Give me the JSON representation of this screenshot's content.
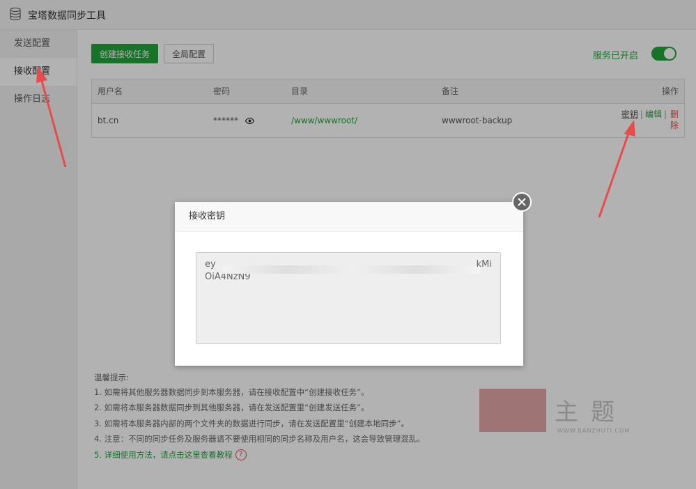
{
  "window": {
    "title": "宝塔数据同步工具"
  },
  "sidebar": {
    "items": [
      {
        "label": "发送配置"
      },
      {
        "label": "接收配置"
      },
      {
        "label": "操作日志"
      }
    ]
  },
  "toolbar": {
    "create_label": "创建接收任务",
    "global_label": "全局配置",
    "service_status": "服务已开启",
    "service_on": true
  },
  "table": {
    "headers": [
      "用户名",
      "密码",
      "目录",
      "备注",
      "操作"
    ],
    "rows": [
      {
        "username": "bt.cn",
        "password": "******",
        "dir": "/www/wwwroot/",
        "note": "wwwroot-backup",
        "ops": {
          "key": "密钥",
          "sep": "|",
          "edit": "编辑",
          "del": "删除"
        }
      }
    ]
  },
  "tips": {
    "title": "温馨提示:",
    "lines": [
      "1. 如需将其他服务器数据同步到本服务器，请在接收配置中“创建接收任务”。",
      "2. 如需将本服务器数据同步到其他服务器，请在发送配置里“创建发送任务”。",
      "3. 如需将本服务器内部的两个文件夹的数据进行同步，请在发送配置里“创建本地同步”。",
      "4. 注意：不同的同步任务及服务器请不要使用相同的同步名称及用户名，这会导致管理混乱。"
    ],
    "link_prefix": "5. ",
    "link_text": "详细使用方法，请点击这里查看教程",
    "help": "?"
  },
  "modal": {
    "title": "接收密钥",
    "key_visible_start": "ey",
    "key_visible_end": "kMi",
    "key_line2": "OiA4NzN9"
  },
  "watermark": {
    "text": "主题",
    "url": "WWW.BANZHUTI.COM"
  },
  "colors": {
    "accent": "#20a53a",
    "danger": "#e94b4b",
    "arrow": "#e94b4b"
  }
}
